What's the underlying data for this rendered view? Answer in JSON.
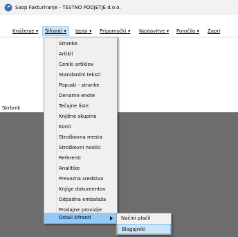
{
  "window": {
    "title": "Saop  Fakturiranje - TESTNO PODJETJE d.o.o.",
    "icon": "app-logo-icon"
  },
  "menubar": {
    "items": [
      {
        "label": "Knjiženje",
        "arrow": "▾"
      },
      {
        "label": "Šifranti",
        "arrow": "▾"
      },
      {
        "label": "Izpisi",
        "arrow": "▾"
      },
      {
        "label": "Pripomočki",
        "arrow": "▾"
      },
      {
        "label": "Nastavitve",
        "arrow": "▾"
      },
      {
        "label": "Poročilo",
        "arrow": "▾"
      },
      {
        "label": "Zapri",
        "arrow": ""
      }
    ]
  },
  "sidebar": {
    "label": "Skrbnik"
  },
  "dropdown": {
    "items": [
      {
        "label": "Stranke"
      },
      {
        "label": "Artikli"
      },
      {
        "label": "Ceniki artiklov"
      },
      {
        "label": "Standardni teksti"
      },
      {
        "label": "Popusti - stranke"
      },
      {
        "label": "Denarne enote"
      },
      {
        "label": "Tečajne liste"
      },
      {
        "label": "Knjižne skupine"
      },
      {
        "label": "Konti"
      },
      {
        "label": "Stroškovna mesta"
      },
      {
        "label": "Stroškovni nosilci"
      },
      {
        "label": "Referenti"
      },
      {
        "label": "Analitike"
      },
      {
        "label": "Prevozna sredstva"
      },
      {
        "label": "Knjige dokumentov"
      },
      {
        "label": "Odpadna embalaža"
      },
      {
        "label": "Prodajne provizije"
      },
      {
        "label": "Ostali šifranti"
      }
    ]
  },
  "submenu": {
    "items": [
      {
        "label": "Načini plačil"
      },
      {
        "label": "Blagajniki"
      }
    ]
  },
  "colors": {
    "selection": "#91c9f7",
    "hover": "#cce4f7",
    "workspace": "#6d6d6d"
  }
}
